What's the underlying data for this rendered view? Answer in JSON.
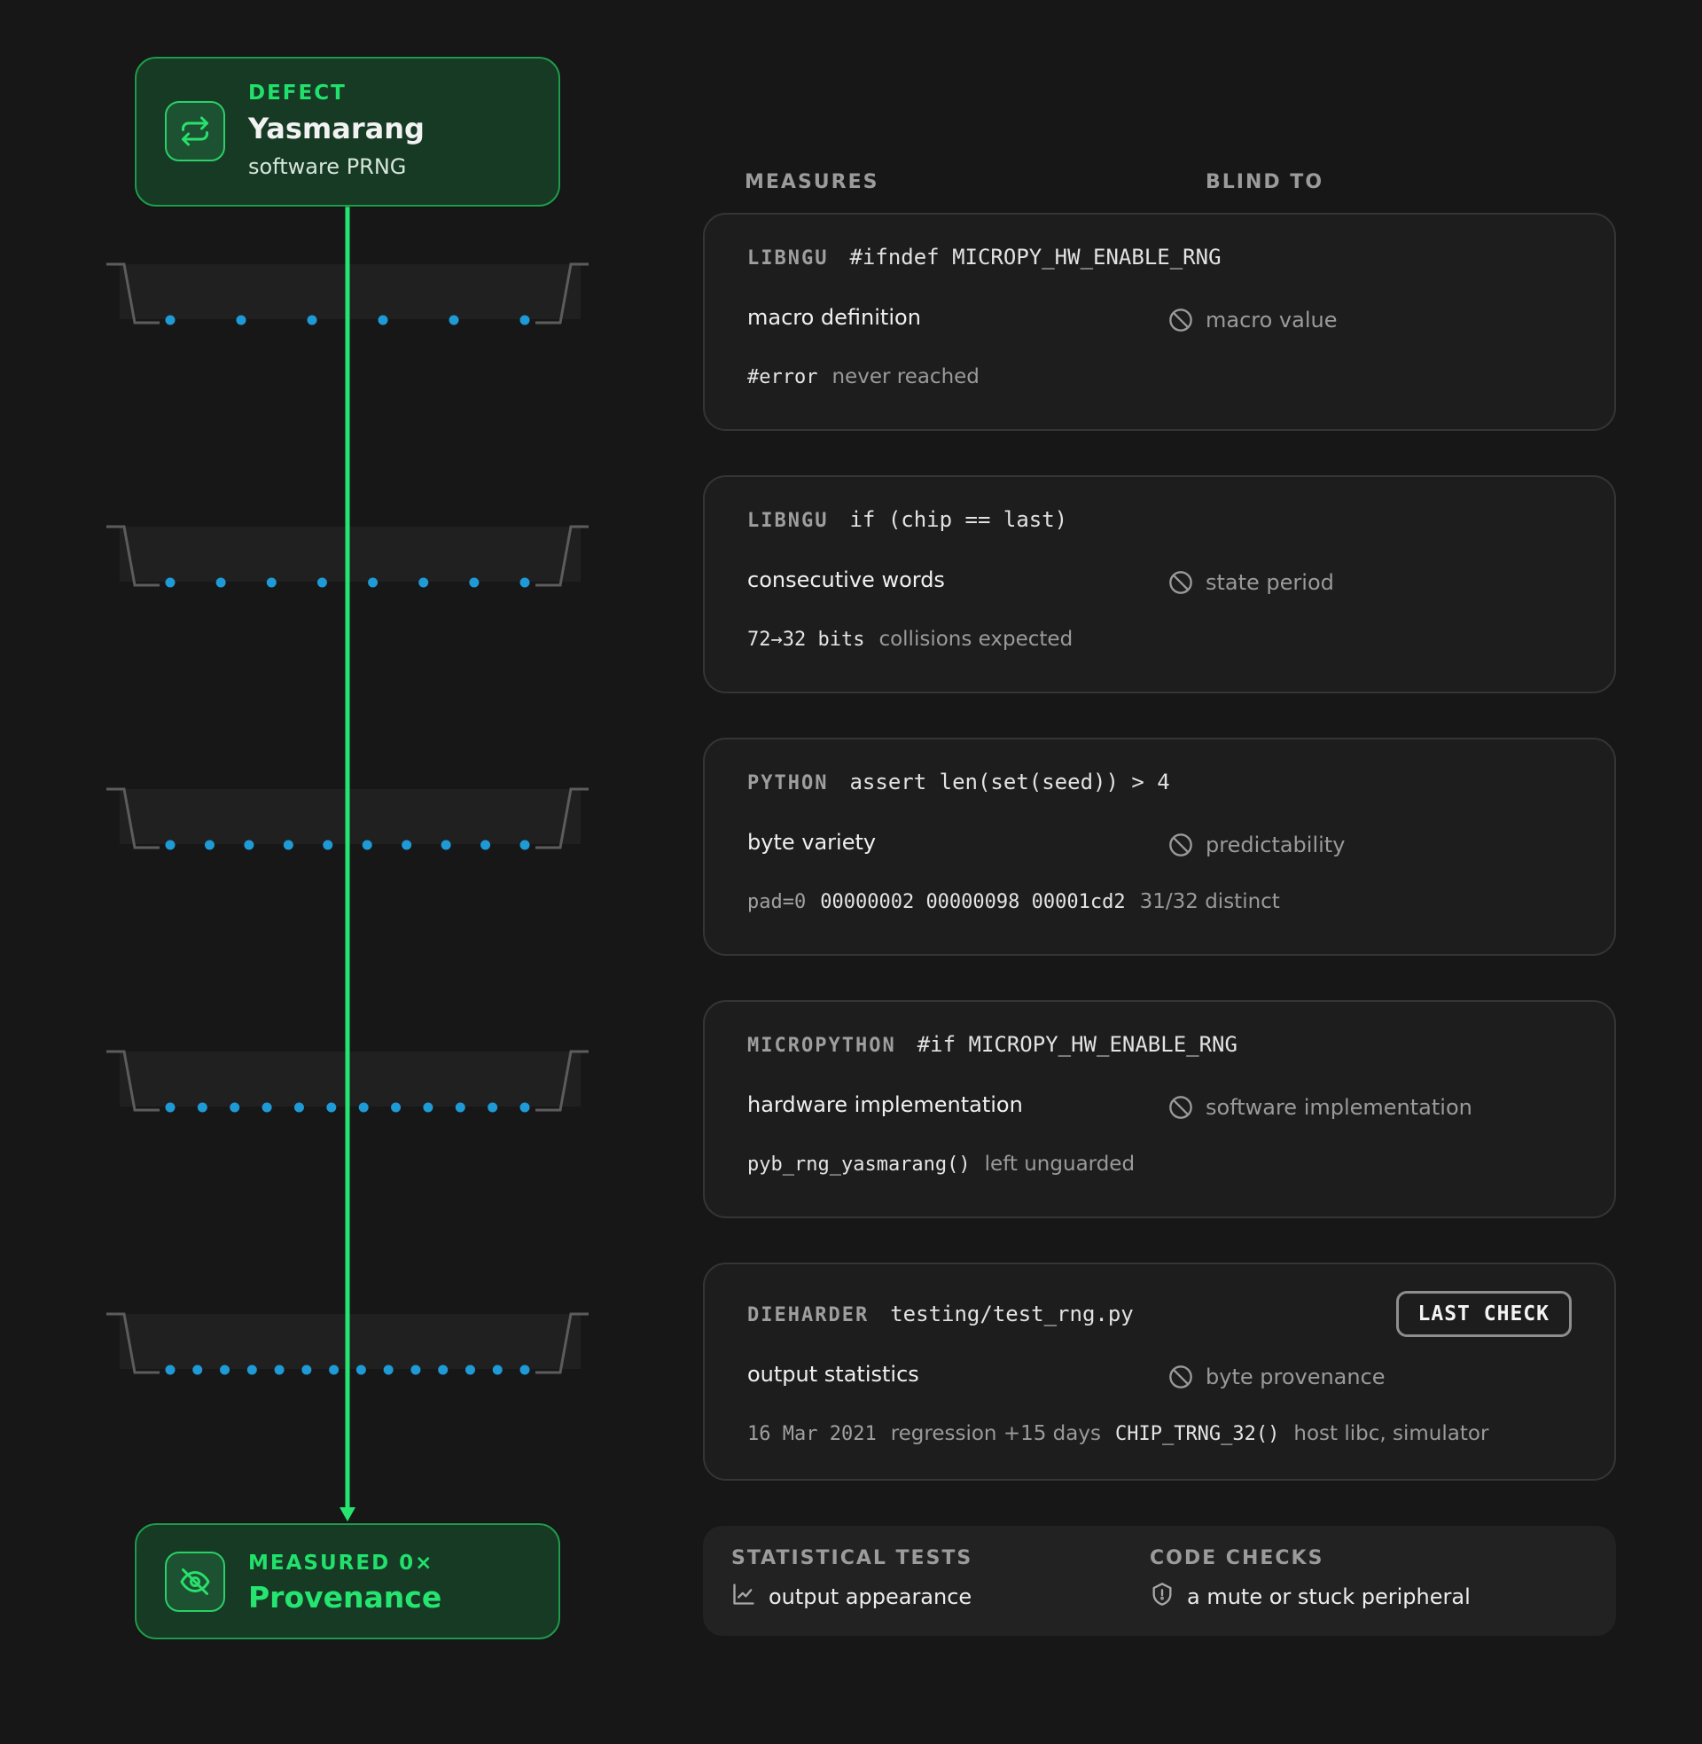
{
  "flow": {
    "top_node": {
      "kicker": "DEFECT",
      "title": "Yasmarang",
      "subtitle": "software PRNG",
      "icon": "repeat-icon"
    },
    "bottom_node": {
      "kicker": "MEASURED 0×",
      "title": "Provenance",
      "icon": "eye-off-icon"
    },
    "filter_stage_dot_counts": [
      6,
      8,
      10,
      12,
      14
    ],
    "colors": {
      "accent": "#22e06c",
      "dots": "#1e9bd6",
      "line": "#25e46f"
    }
  },
  "headers": {
    "measures": "MEASURES",
    "blind_to": "BLIND TO"
  },
  "checks": [
    {
      "tag": "LIBNGU",
      "code": "#ifndef MICROPY_HW_ENABLE_RNG",
      "measures": "macro definition",
      "blind_to": "macro value",
      "detail_code": "#error",
      "detail_text": "never reached"
    },
    {
      "tag": "LIBNGU",
      "code": "if (chip == last)",
      "measures": "consecutive words",
      "blind_to": "state period",
      "detail_code": "72→32 bits",
      "detail_text": "collisions expected"
    },
    {
      "tag": "PYTHON",
      "code": "assert len(set(seed)) > 4",
      "measures": "byte variety",
      "blind_to": "predictability",
      "detail_dim": "pad=0",
      "detail_code": "00000002 00000098 00001cd2",
      "detail_text": "31/32 distinct"
    },
    {
      "tag": "MICROPYTHON",
      "code": "#if MICROPY_HW_ENABLE_RNG",
      "measures": "hardware implementation",
      "blind_to": "software implementation",
      "detail_code": "pyb_rng_yasmarang()",
      "detail_text": "left unguarded"
    },
    {
      "tag": "DIEHARDER",
      "code": "testing/test_rng.py",
      "badge": "LAST CHECK",
      "measures": "output statistics",
      "blind_to": "byte provenance",
      "detail_dim": "16 Mar 2021",
      "detail_text": "regression +15 days",
      "detail_code": "CHIP_TRNG_32()",
      "detail_text2": "host libc, simulator"
    }
  ],
  "summary": {
    "statistical": {
      "heading": "STATISTICAL TESTS",
      "item": "output appearance",
      "icon": "chart-line-icon"
    },
    "code": {
      "heading": "CODE CHECKS",
      "item": "a mute or stuck peripheral",
      "icon": "shield-icon"
    }
  }
}
